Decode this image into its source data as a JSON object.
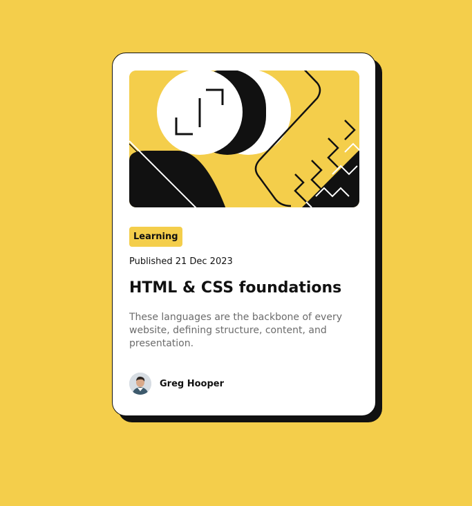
{
  "colors": {
    "background": "#F4CE4B",
    "card": "#FFFFFF",
    "ink": "#111111",
    "muted_text": "#6B6B6B"
  },
  "card": {
    "illustration_icon": "abstract-illustration",
    "tag": "Learning",
    "published": "Published 21 Dec 2023",
    "title": "HTML & CSS foundations",
    "description": "These languages are the backbone of every website, defining structure, content, and presentation.",
    "author": {
      "name": "Greg Hooper",
      "avatar_icon": "avatar"
    }
  }
}
